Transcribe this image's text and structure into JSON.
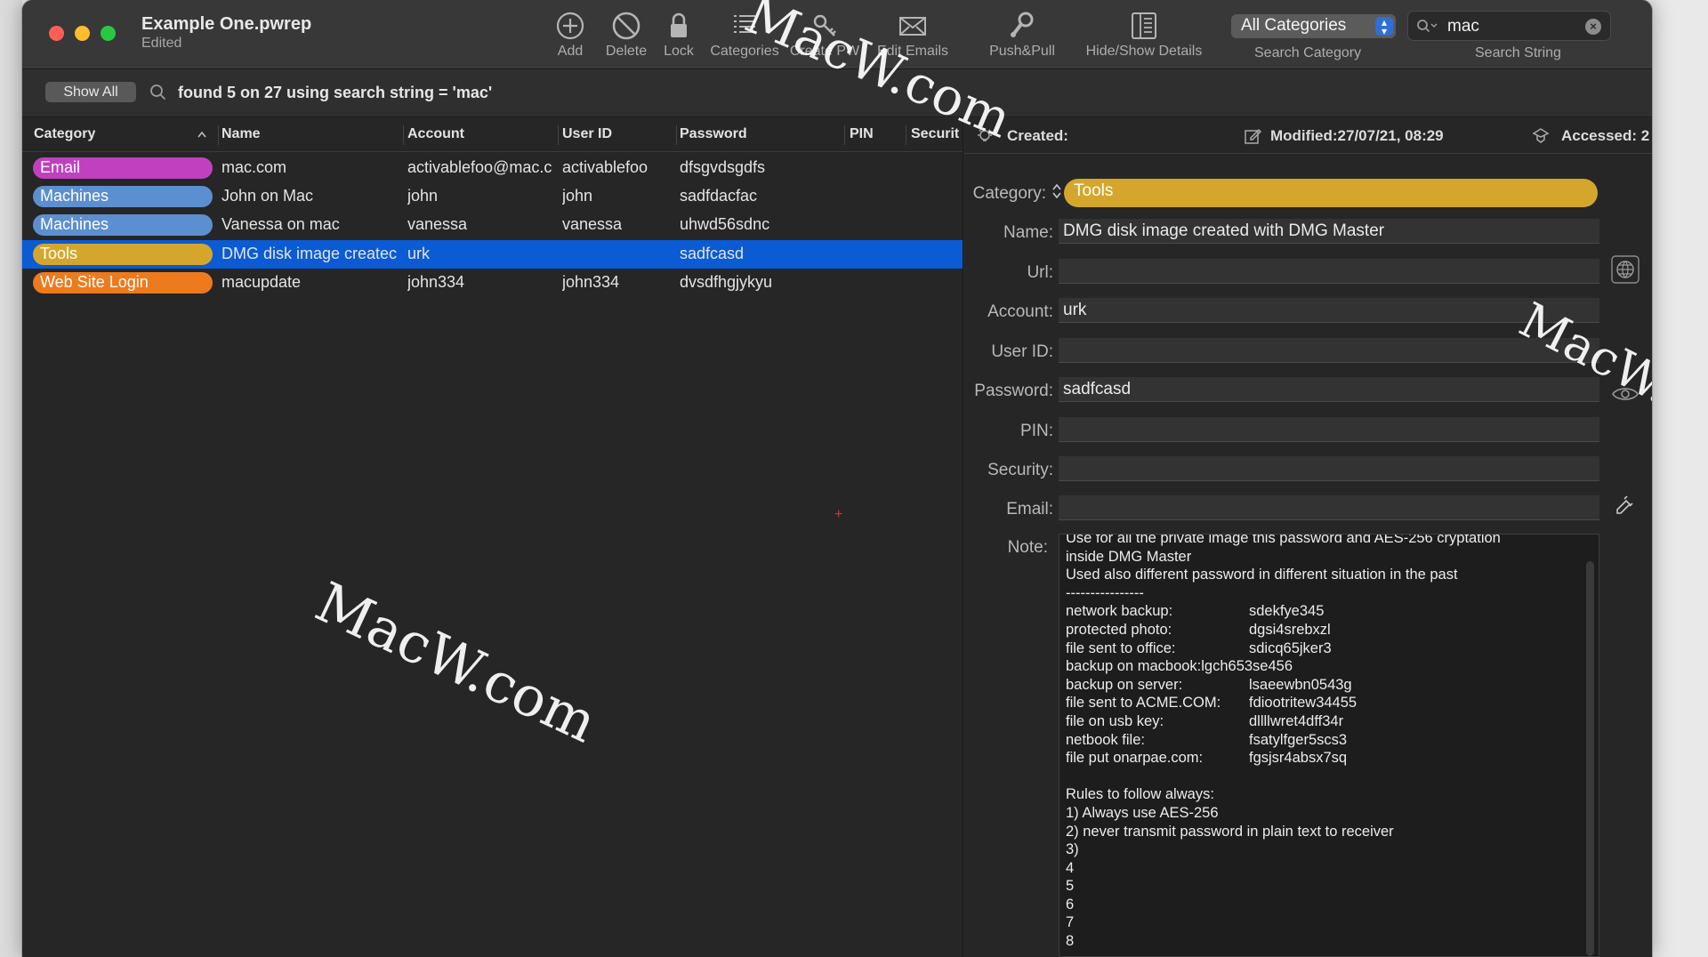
{
  "window": {
    "title": "Example One.pwrep",
    "subtitle": "Edited"
  },
  "toolbar": {
    "buttons": [
      {
        "label": "Add",
        "icon": "add-icon"
      },
      {
        "label": "Delete",
        "icon": "delete-icon"
      },
      {
        "label": "Lock",
        "icon": "lock-icon"
      },
      {
        "label": "Categories",
        "icon": "categories-icon"
      },
      {
        "label": "Create PW",
        "icon": "key-icon"
      },
      {
        "label": "Edit Emails",
        "icon": "envelope-icon"
      },
      {
        "label": "Push&Pull",
        "icon": "push-pull-icon"
      },
      {
        "label": "Hide/Show Details",
        "icon": "details-panel-icon"
      }
    ],
    "category_select": {
      "value": "All Categories",
      "caption": "Search Category"
    },
    "search": {
      "value": "mac",
      "caption": "Search String"
    }
  },
  "filter": {
    "show_all_label": "Show All",
    "status_text": "found 5 on 27 using  search string = 'mac'"
  },
  "table": {
    "columns": [
      "Category",
      "Name",
      "Account",
      "User ID",
      "Password",
      "PIN",
      "Securit"
    ],
    "rows": [
      {
        "category": "Email",
        "category_color": "#c040c0",
        "name": "mac.com",
        "account": "activablefoo@mac.c",
        "user_id": "activablefoo",
        "password": "dfsgvdsgdfs",
        "pin": "",
        "security": ""
      },
      {
        "category": "Machines",
        "category_color": "#5c8fd0",
        "name": "John on Mac",
        "account": "john",
        "user_id": "john",
        "password": "sadfdacfac",
        "pin": "",
        "security": ""
      },
      {
        "category": "Machines",
        "category_color": "#5c8fd0",
        "name": "Vanessa on mac",
        "account": "vanessa",
        "user_id": "vanessa",
        "password": "uhwd56sdnc",
        "pin": "",
        "security": ""
      },
      {
        "category": "Tools",
        "category_color": "#d4a72c",
        "name": "DMG disk image createc",
        "account": "urk",
        "user_id": "",
        "password": "sadfcasd",
        "pin": "",
        "security": "",
        "selected": true
      },
      {
        "category": "Web Site Login",
        "category_color": "#ee7a1e",
        "name": "macupdate",
        "account": "john334",
        "user_id": "john334",
        "password": "dvsdfhgjykyu",
        "pin": "",
        "security": ""
      }
    ]
  },
  "detail": {
    "created_label": "Created:",
    "modified_label": "Modified:27/07/21, 08:29",
    "accessed_label": "Accessed: 2",
    "category_label": "Category:",
    "category_value": "Tools",
    "name_label": "Name:",
    "name_value": "DMG disk image created with DMG Master",
    "url_label": "Url:",
    "url_value": "",
    "account_label": "Account:",
    "account_value": "urk",
    "userid_label": "User ID:",
    "userid_value": "",
    "password_label": "Password:",
    "password_value": "sadfcasd",
    "pin_label": "PIN:",
    "pin_value": "",
    "security_label": "Security:",
    "security_value": "",
    "email_label": "Email:",
    "email_value": "",
    "note_label": "Note:",
    "note_lines": [
      {
        "text": "Use for all the private image this password and AES-256 cryptation"
      },
      {
        "text": "inside DMG Master"
      },
      {
        "text": "Used also different password in different situation in the past"
      },
      {
        "text": "----------------"
      },
      {
        "key": "network backup:",
        "val": "sdekfye345"
      },
      {
        "key": "protected photo:",
        "val": "dgsi4srebxzl"
      },
      {
        "key": "file sent to office:",
        "val": "sdicq65jker3"
      },
      {
        "text": "backup on macbook:lgch653se456"
      },
      {
        "key": "backup on server:",
        "val": "lsaeewbn0543g"
      },
      {
        "key": "file sent to ACME.COM:",
        "val": "fdiootritew34455"
      },
      {
        "key": "file on usb key:",
        "val": "dllllwret4dff34r"
      },
      {
        "key": "netbook file:",
        "val": "fsatylfger5scs3"
      },
      {
        "key": "file put onarpae.com:",
        "val": "fgsjsr4absx7sq"
      },
      {
        "text": ""
      },
      {
        "text": "Rules to follow always:"
      },
      {
        "text": "1) Always use AES-256"
      },
      {
        "text": "2) never transmit password in plain text to receiver"
      },
      {
        "text": "3)"
      },
      {
        "text": "4"
      },
      {
        "text": "5"
      },
      {
        "text": "6"
      },
      {
        "text": "7"
      },
      {
        "text": "8"
      }
    ]
  },
  "watermarks": [
    "MacW.com",
    "MacW.com",
    "MacW.com"
  ]
}
